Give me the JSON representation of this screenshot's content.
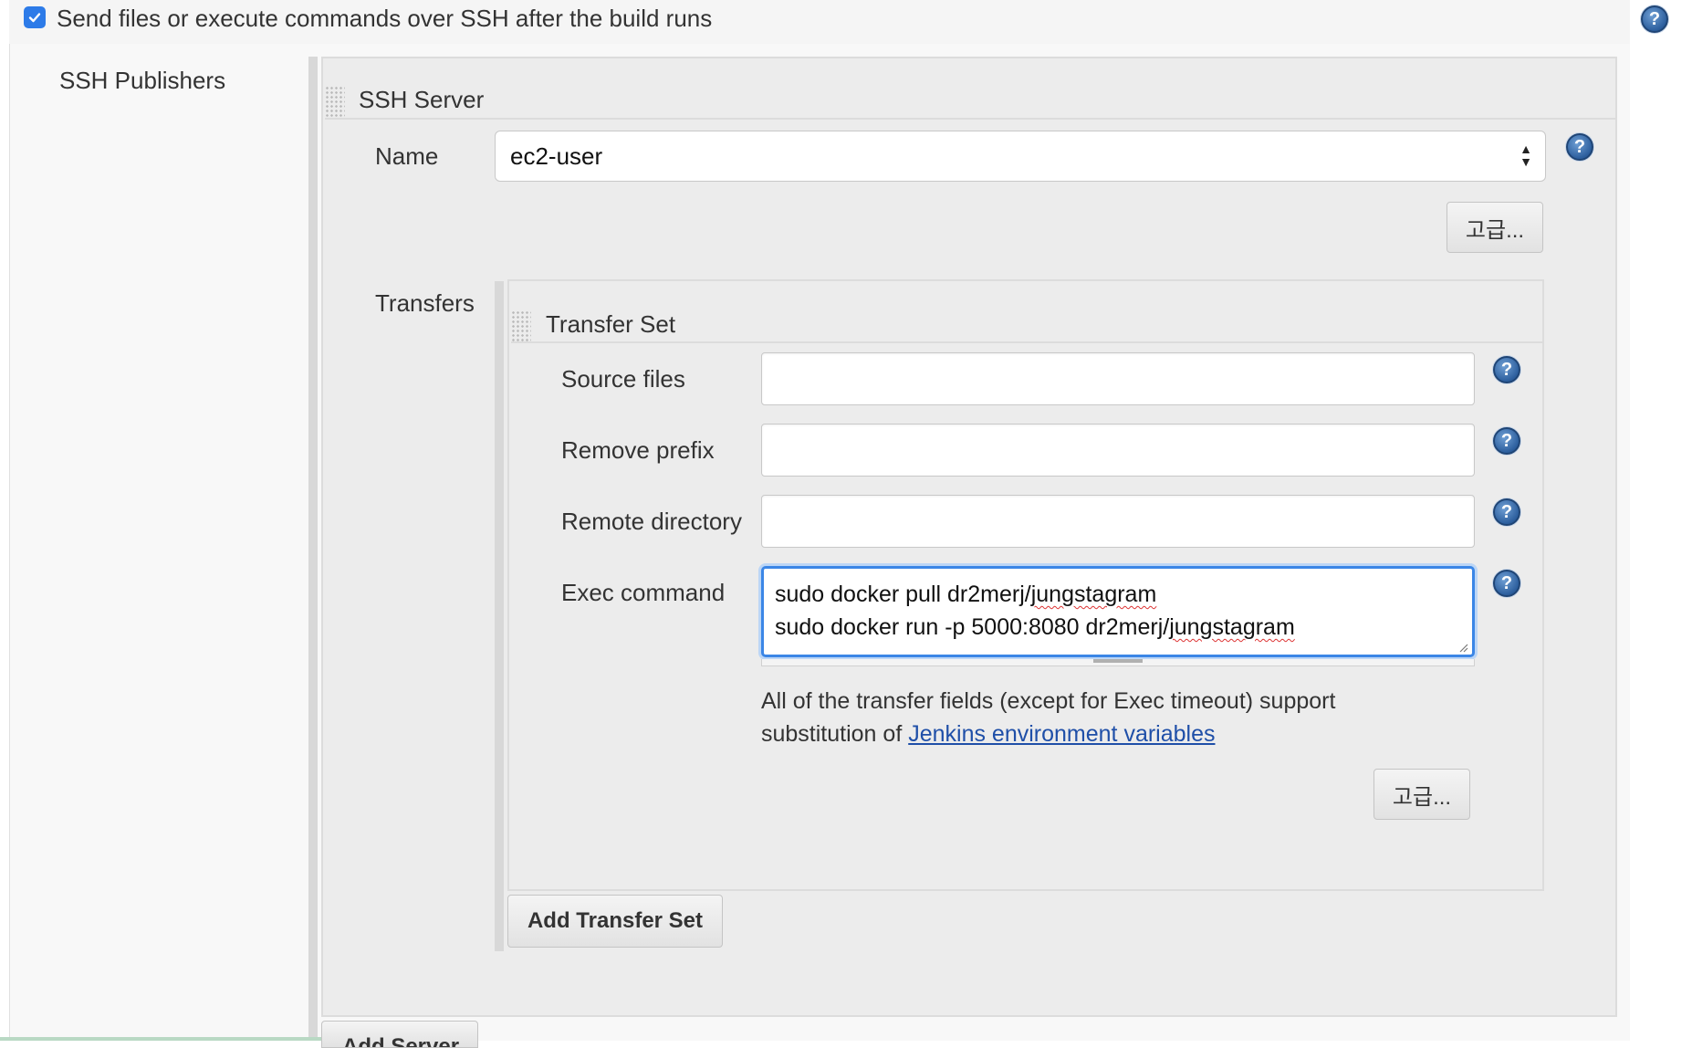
{
  "publish_step": {
    "checkbox_checked": true,
    "label": "Send files or execute commands over SSH after the build runs"
  },
  "section": {
    "label": "SSH Publishers"
  },
  "ssh_server": {
    "title": "SSH Server",
    "name_label": "Name",
    "name_value": "ec2-user",
    "advanced_button": "고급..."
  },
  "transfers": {
    "label": "Transfers",
    "transfer_set": {
      "title": "Transfer Set",
      "source_files_label": "Source files",
      "source_files_value": "",
      "remove_prefix_label": "Remove prefix",
      "remove_prefix_value": "",
      "remote_directory_label": "Remote directory",
      "remote_directory_value": "",
      "exec_command_label": "Exec command",
      "exec_command_lines": [
        "sudo docker pull dr2merj/jungstagram",
        "sudo docker run -p 5000:8080 dr2merj/jungstagram"
      ],
      "info_text": "All of the transfer fields (except for Exec timeout) support substitution of",
      "info_link": "Jenkins environment variables",
      "advanced_button": "고급..."
    },
    "add_transfer_set_button": "Add Transfer Set"
  },
  "add_server_button": "Add Server",
  "colors": {
    "accent": "#2d7be8",
    "focus_border": "#3b86e6",
    "link": "#1f4fa8",
    "help_icon": "#2d5f9e"
  }
}
